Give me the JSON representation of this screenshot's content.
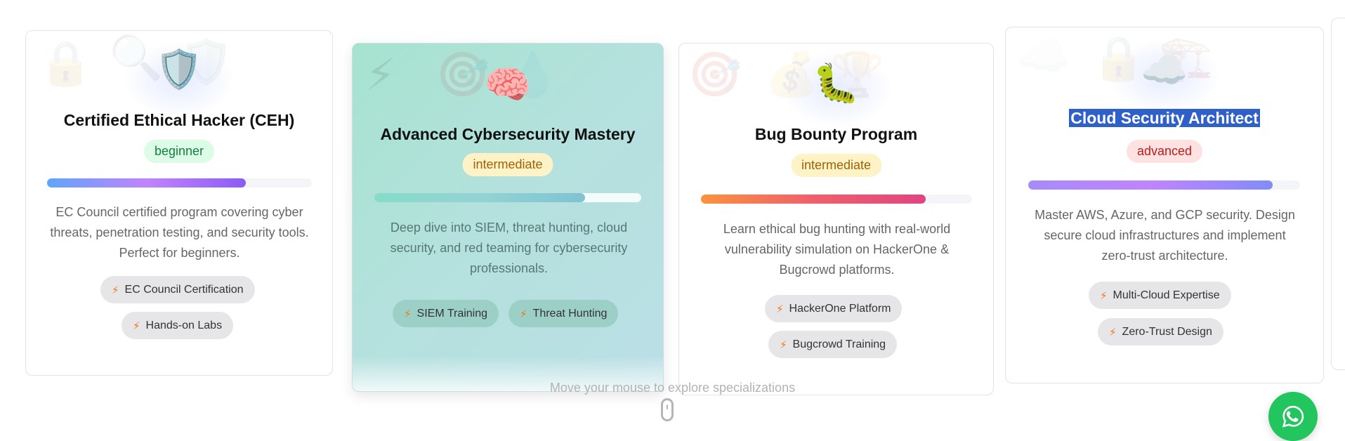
{
  "cards": [
    {
      "icon": "shield-icon",
      "emoji": "🛡️",
      "bg_icons": [
        "🔒",
        "🔍",
        "🛡️"
      ],
      "title": "Certified Ethical Hacker (CEH)",
      "level": "beginner",
      "progress": 0.75,
      "gradient": [
        "#60a5fa",
        "#c084fc",
        "#8b5cf6"
      ],
      "description": "EC Council certified program covering cyber threats, penetration testing, and security tools. Perfect for beginners.",
      "tags": [
        "EC Council Certification",
        "Hands-on Labs"
      ]
    },
    {
      "icon": "brain-icon",
      "emoji": "🧠",
      "bg_icons": [
        "⚡",
        "🎯",
        "💧"
      ],
      "title": "Advanced Cybersecurity Mastery",
      "level": "intermediate",
      "progress": 0.79,
      "gradient": [
        "#86dcc8",
        "#93d3d4",
        "#7fc3d4"
      ],
      "description": "Deep dive into SIEM, threat hunting, cloud security, and red teaming for cybersecurity professionals.",
      "tags": [
        "SIEM Training",
        "Threat Hunting"
      ]
    },
    {
      "icon": "bug-icon",
      "emoji": "🐛",
      "bg_icons": [
        "🎯",
        "💰",
        "🏆"
      ],
      "title": "Bug Bounty Program",
      "level": "intermediate",
      "progress": 0.83,
      "gradient": [
        "#fb923c",
        "#f05f6d",
        "#e0457f"
      ],
      "description": "Learn ethical bug hunting with real-world vulnerability simulation on HackerOne & Bugcrowd platforms.",
      "tags": [
        "HackerOne Platform",
        "Bugcrowd Training"
      ]
    },
    {
      "icon": "cloud-icon",
      "emoji": "☁️",
      "bg_icons": [
        "☁️",
        "🔒",
        "🏗️"
      ],
      "title": "Cloud Security Architect",
      "level": "advanced",
      "progress": 0.9,
      "gradient": [
        "#a78bfa",
        "#c084fc",
        "#818cf8"
      ],
      "description": "Master AWS, Azure, and GCP security. Design secure cloud infrastructures and implement zero-trust architecture.",
      "tags": [
        "Multi-Cloud Expertise",
        "Zero-Trust Design"
      ]
    }
  ],
  "hint": "Move your mouse to explore specializations",
  "whatsapp": "whatsapp-icon"
}
